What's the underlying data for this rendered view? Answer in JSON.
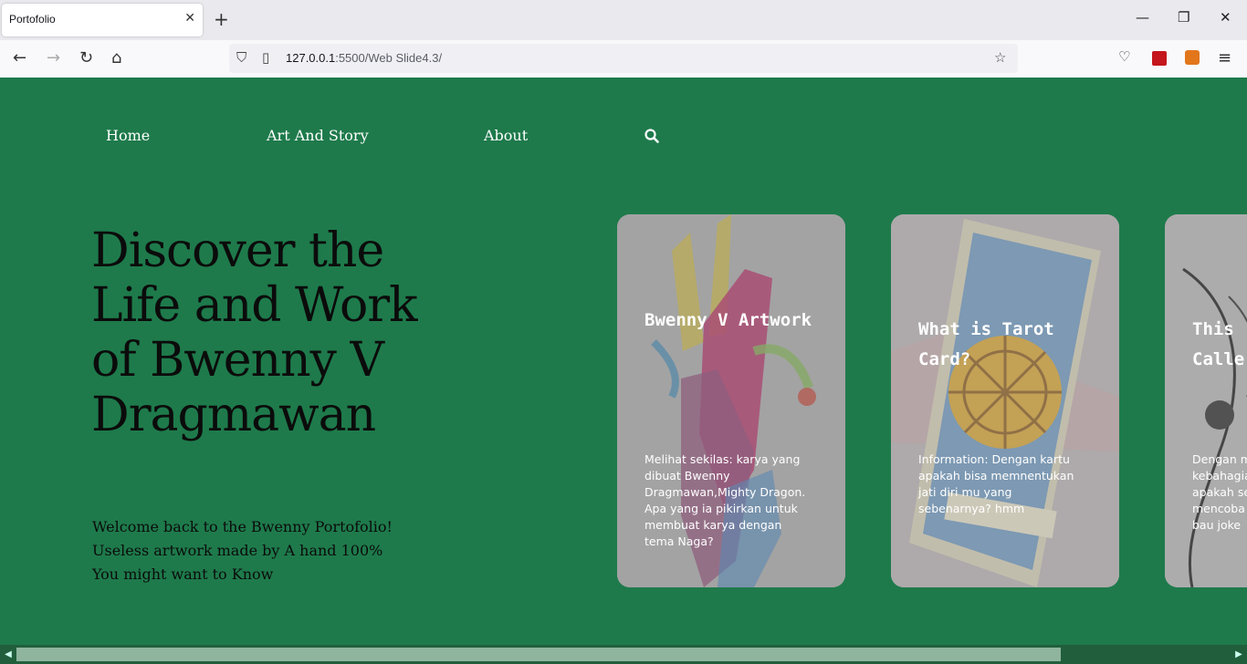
{
  "browser": {
    "tab_title": "Portofolio",
    "url_host": "127.0.0.1",
    "url_path": ":5500/Web Slide4.3/"
  },
  "nav": {
    "items": [
      {
        "label": "Home"
      },
      {
        "label": "Art And Story"
      },
      {
        "label": "About"
      }
    ]
  },
  "hero": {
    "title": "Discover the Life and Work of Bwenny V Dragmawan",
    "lines": [
      "Welcome back to the Bwenny Portofolio!",
      "Useless artwork made by A hand 100%",
      "You might want to Know"
    ]
  },
  "cards": [
    {
      "title": "Bwenny V Artwork",
      "description": "Melihat sekilas: karya yang dibuat Bwenny Dragmawan,Mighty Dragon. Apa yang ia pikirkan untuk membuat karya dengan tema Naga?"
    },
    {
      "title": "What is Tarot Card?",
      "description": "Information: Dengan kartu apakah bisa memnentukan jati diri mu yang sebenarnya? hmm"
    },
    {
      "title": "This Calle",
      "description": "Dengan m kebahagia apakah se mencoba bau joke"
    }
  ],
  "scroll": {
    "position": 0.86
  },
  "colors": {
    "page_bg": "#1e7a4b",
    "nav_text": "#ffffff",
    "hero_text": "#0b0b0b"
  }
}
